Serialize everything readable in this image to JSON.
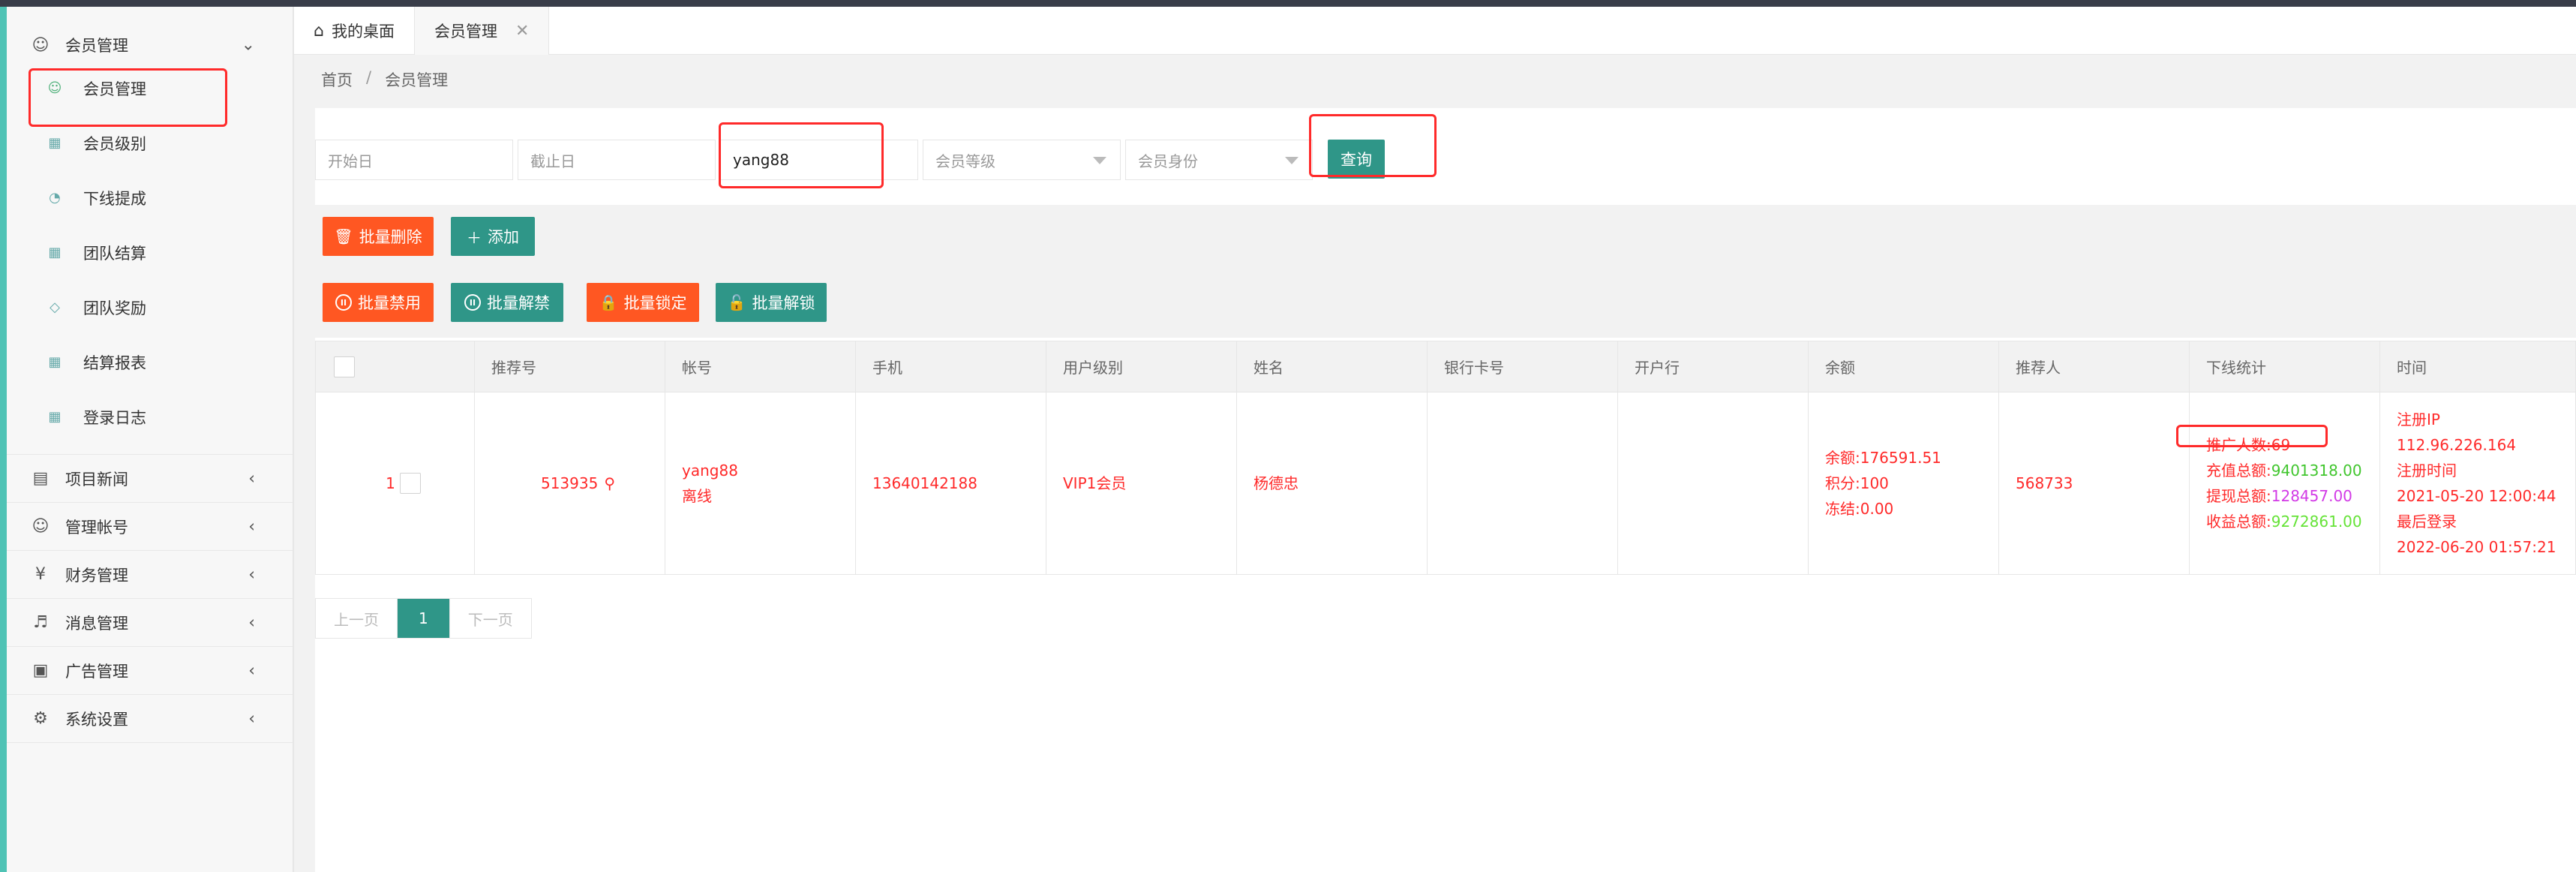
{
  "sidebar": {
    "top_group": {
      "label": "会员管理",
      "icon": "user-icon"
    },
    "sub_items": [
      {
        "label": "会员管理",
        "icon": "user-icon"
      },
      {
        "label": "会员级别",
        "icon": "level-icon"
      },
      {
        "label": "下线提成",
        "icon": "gauge-icon"
      },
      {
        "label": "团队结算",
        "icon": "settle-icon"
      },
      {
        "label": "团队奖励",
        "icon": "diamond-icon"
      },
      {
        "label": "结算报表",
        "icon": "report-icon"
      },
      {
        "label": "登录日志",
        "icon": "calendar-icon"
      }
    ],
    "groups": [
      {
        "label": "项目新闻",
        "icon": "book-icon"
      },
      {
        "label": "管理帐号",
        "icon": "admin-icon"
      },
      {
        "label": "财务管理",
        "icon": "yen-icon"
      },
      {
        "label": "消息管理",
        "icon": "speaker-icon"
      },
      {
        "label": "广告管理",
        "icon": "image-icon"
      },
      {
        "label": "系统设置",
        "icon": "gear-icon"
      }
    ]
  },
  "tabs": [
    {
      "label": "我的桌面",
      "icon": "home-icon"
    },
    {
      "label": "会员管理",
      "close": "✕"
    }
  ],
  "breadcrumb": {
    "home": "首页",
    "sep": "/",
    "current": "会员管理"
  },
  "filters": {
    "start_placeholder": "开始日",
    "end_placeholder": "截止日",
    "keyword_value": "yang88",
    "level_placeholder": "会员等级",
    "identity_placeholder": "会员身份",
    "query_label": "查询"
  },
  "toolbar": {
    "batch_delete": "批量删除",
    "add": "添加",
    "batch_disable": "批量禁用",
    "batch_enable": "批量解禁",
    "batch_lock": "批量锁定",
    "batch_unlock": "批量解锁"
  },
  "table": {
    "headers": [
      "推荐号",
      "帐号",
      "手机",
      "用户级别",
      "姓名",
      "银行卡号",
      "开户行",
      "余额",
      "推荐人",
      "下线统计",
      "时间"
    ],
    "row": {
      "index": "1",
      "ref_no": "513935",
      "account": "yang88",
      "status": "离线",
      "phone": "13640142188",
      "level": "VIP1会员",
      "name": "杨德忠",
      "bank_card": "",
      "bank": "",
      "balance": "余额:176591.51",
      "points": "积分:100",
      "frozen": "冻结:0.00",
      "referrer": "568733",
      "stats": {
        "promoters": "推广人数:69",
        "recharge_label": "充值总额:",
        "recharge_value": "9401318.00",
        "withdraw_label": "提现总额:",
        "withdraw_value": "128457.00",
        "income_label": "收益总额:",
        "income_value": "9272861.00"
      },
      "time": {
        "reg_ip_label": "注册IP",
        "reg_ip": "112.96.226.164",
        "reg_time_label": "注册时间",
        "reg_time": "2021-05-20 12:00:44",
        "last_login_label": "最后登录",
        "last_login": "2022-06-20 01:57:21"
      }
    }
  },
  "pager": {
    "prev": "上一页",
    "current": "1",
    "next": "下一页"
  },
  "colors": {
    "accent": "#2f9688",
    "danger": "#ff5722",
    "highlight": "#ff2a2a"
  }
}
